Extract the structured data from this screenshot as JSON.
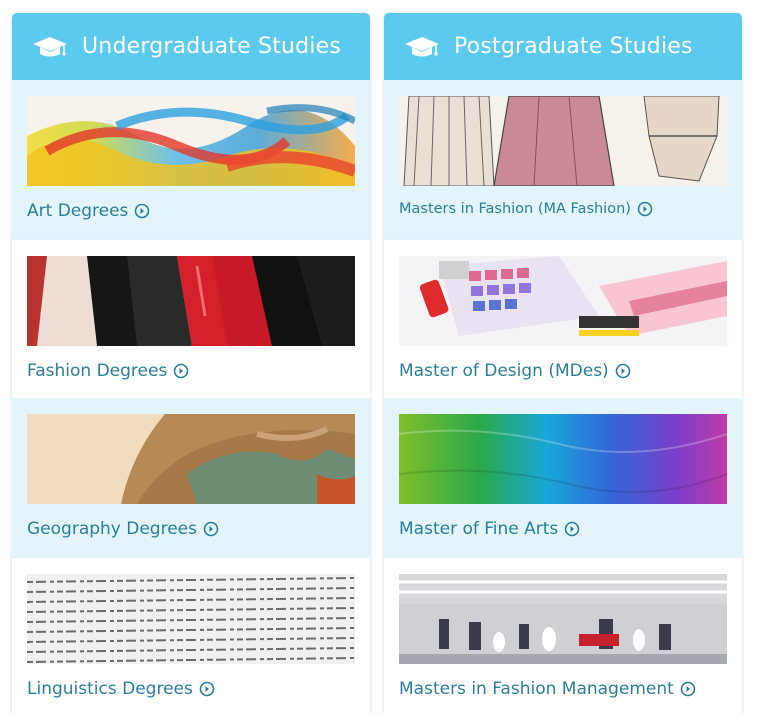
{
  "colors": {
    "header": "#5cc9ee",
    "shade": "#e3f4fb",
    "link": "#2a7f97"
  },
  "columns": [
    {
      "title": "Undergraduate Studies",
      "icon": "graduation-cap-icon",
      "items": [
        {
          "label": "Art Degrees",
          "image": "ink-splash-image"
        },
        {
          "label": "Fashion Degrees",
          "image": "high-heels-image"
        },
        {
          "label": "Geography Degrees",
          "image": "globe-image"
        },
        {
          "label": "Linguistics Degrees",
          "image": "printed-text-image"
        }
      ]
    },
    {
      "title": "Postgraduate Studies",
      "icon": "graduation-cap-icon",
      "items": [
        {
          "label": "Masters in Fashion (MA Fashion)",
          "image": "fashion-sketch-image"
        },
        {
          "label": "Master of Design (MDes)",
          "image": "color-swatches-image"
        },
        {
          "label": "Master of Fine Arts",
          "image": "rainbow-paint-image"
        },
        {
          "label": "Masters in Fashion Management",
          "image": "boutique-interior-image"
        }
      ]
    }
  ]
}
